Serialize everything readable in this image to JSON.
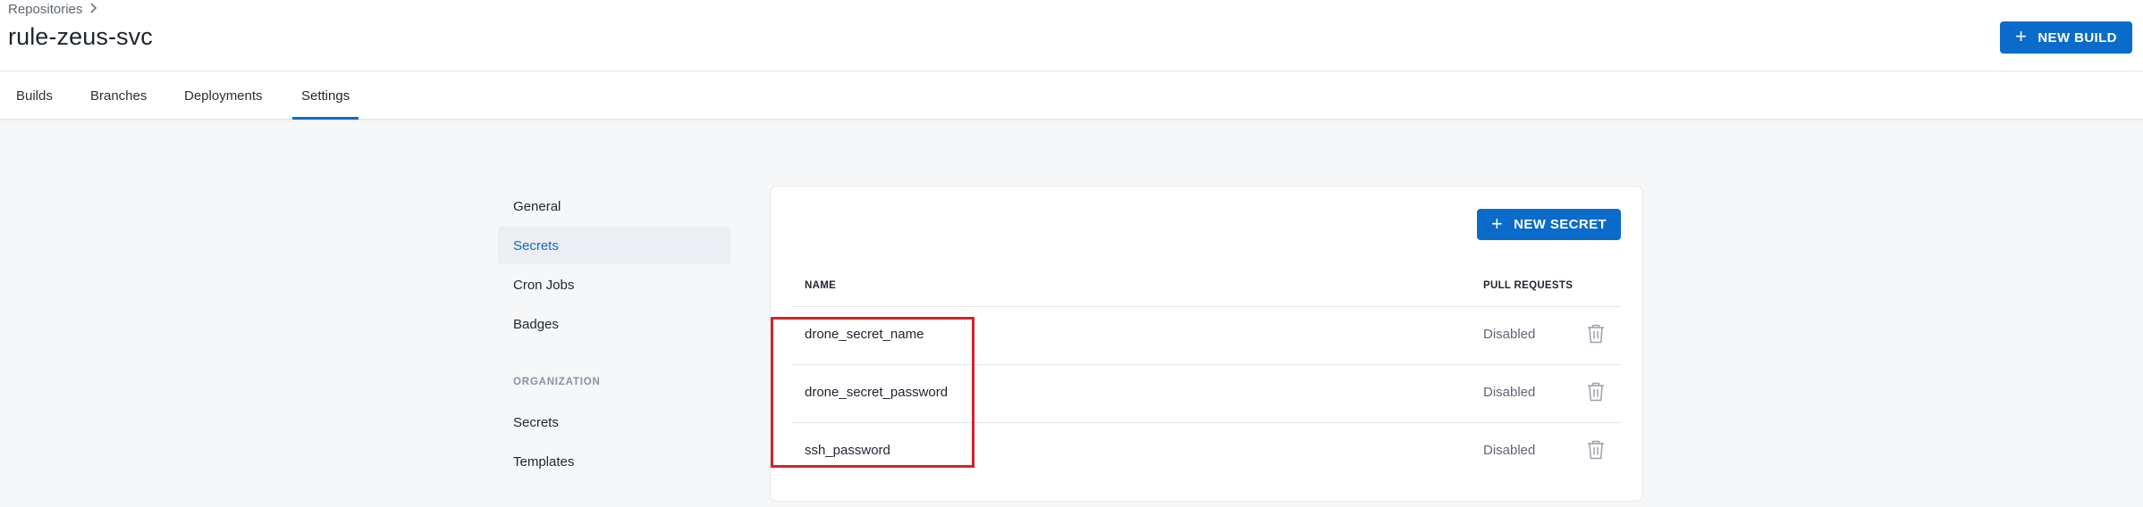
{
  "header": {
    "breadcrumb": "Repositories",
    "title": "rule-zeus-svc",
    "new_build_label": "NEW BUILD"
  },
  "tabs": [
    {
      "label": "Builds"
    },
    {
      "label": "Branches"
    },
    {
      "label": "Deployments"
    },
    {
      "label": "Settings",
      "active": true
    }
  ],
  "sidebar": {
    "items": [
      {
        "label": "General"
      },
      {
        "label": "Secrets",
        "active": true
      },
      {
        "label": "Cron Jobs"
      },
      {
        "label": "Badges"
      }
    ],
    "org_section": "ORGANIZATION",
    "org_items": [
      {
        "label": "Secrets"
      },
      {
        "label": "Templates"
      }
    ]
  },
  "secrets": {
    "new_secret_label": "NEW SECRET",
    "columns": {
      "name": "NAME",
      "pull_requests": "PULL REQUESTS"
    },
    "rows": [
      {
        "name": "drone_secret_name",
        "pull_requests": "Disabled"
      },
      {
        "name": "drone_secret_password",
        "pull_requests": "Disabled"
      },
      {
        "name": "ssh_password",
        "pull_requests": "Disabled"
      }
    ]
  },
  "colors": {
    "accent": "#0b6bcb",
    "highlight_border": "#d0262b",
    "page_bg": "#f6f7f9"
  },
  "icons": {
    "breadcrumb_separator": "chevron-right-icon",
    "button_icon": "plus-icon",
    "row_action": "trash-icon"
  }
}
